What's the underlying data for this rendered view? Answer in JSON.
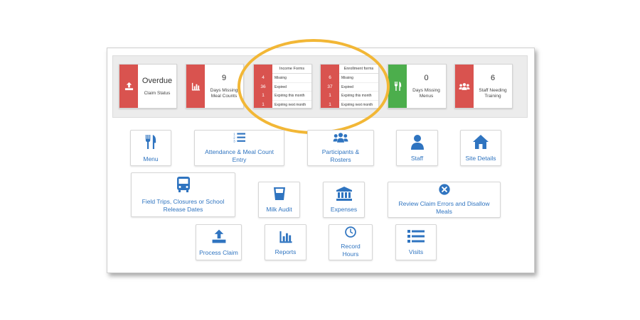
{
  "status_cards": {
    "claim": {
      "value": "Overdue",
      "label": "Claim Status",
      "icon": "upload-icon"
    },
    "meal_counts": {
      "value": "9",
      "label": "Days Missing Meal Counts",
      "icon": "bar-chart-icon"
    },
    "menus": {
      "value": "0",
      "label": "Days Missing Menus",
      "icon": "fork-knife-icon"
    },
    "training": {
      "value": "6",
      "label": "Staff Needing Training",
      "icon": "group-icon"
    }
  },
  "income_forms": {
    "title": "Income Forms",
    "rows": [
      {
        "count": "4",
        "label": "Missing"
      },
      {
        "count": "36",
        "label": "Expired"
      },
      {
        "count": "1",
        "label": "Expiring this month"
      },
      {
        "count": "1",
        "label": "Expiring next month"
      }
    ]
  },
  "enrollment_forms": {
    "title": "Enrollment forms",
    "rows": [
      {
        "count": "6",
        "label": "Missing"
      },
      {
        "count": "37",
        "label": "Expired"
      },
      {
        "count": "1",
        "label": "Expiring this month"
      },
      {
        "count": "1",
        "label": "Expiring next month"
      }
    ]
  },
  "tiles": {
    "menu": "Menu",
    "attendance": "Attendance & Meal Count Entry",
    "participants": "Participants & Rosters",
    "staff": "Staff",
    "site_details": "Site Details",
    "field_trips": "Field Trips, Closures or School Release Dates",
    "milk_audit": "Milk Audit",
    "expenses": "Expenses",
    "review_claim": "Review Claim Errors and Disallow Meals",
    "process_claim": "Process Claim",
    "reports": "Reports",
    "record_hours": "Record Hours",
    "visits": "Visits"
  },
  "colors": {
    "red": "#d9534f",
    "green": "#4cae4c",
    "blue": "#2f74c0",
    "highlight": "#f2b736"
  }
}
